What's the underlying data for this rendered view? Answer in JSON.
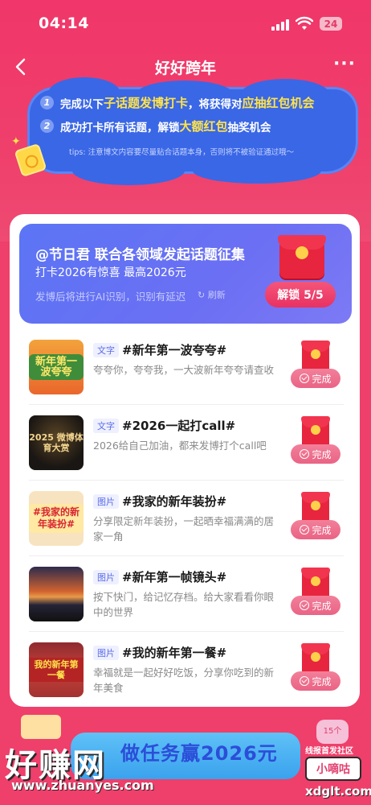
{
  "status_bar": {
    "time": "04:14",
    "battery": "24"
  },
  "nav": {
    "title": "好好跨年"
  },
  "rules": {
    "line1": {
      "num": "1",
      "prefix": "完成以下",
      "h1": "子话题发博打卡",
      "mid": "，将获得对",
      "h2": "应抽红包机会"
    },
    "line2": {
      "num": "2",
      "prefix": "成功打卡所有话题，解锁",
      "h1": "大额红包",
      "suffix": "抽奖机会"
    },
    "tips": "tips: 注意博文内容要尽量贴合话题本身，否则将不被验证通过哦～"
  },
  "banner": {
    "title": "@节日君 联合各领域发起话题征集",
    "subtitle": "打卡2026有惊喜 最高2026元",
    "note": "发博后将进行AI识别，识别有延迟",
    "refresh": "刷新",
    "unlock": "解锁 5/5"
  },
  "tasks": [
    {
      "tag": "文字",
      "title": "#新年第一波夸夸#",
      "desc": "夸夸你，夸夸我，一大波新年夸夸请查收",
      "thumb": "新年第一波夸夸",
      "status": "完成"
    },
    {
      "tag": "文字",
      "title": "#2026一起打call#",
      "desc": "2026给自己加油，都来发博打个call吧",
      "thumb": "2025 微博体育大赏",
      "status": "完成"
    },
    {
      "tag": "图片",
      "title": "#我家的新年装扮#",
      "desc": "分享限定新年装扮，一起晒幸福满满的居家一角",
      "thumb": "#我家的新年装扮#",
      "status": "完成"
    },
    {
      "tag": "图片",
      "title": "#新年第一帧镜头#",
      "desc": "按下快门，给记忆存档。给大家看看你眼中的世界",
      "thumb": "",
      "status": "完成"
    },
    {
      "tag": "图片",
      "title": "#我的新年第一餐#",
      "desc": "幸福就是一起好好吃饭，分享你吃到的新年美食",
      "thumb": "我的新年第一餐",
      "status": "完成"
    }
  ],
  "bottom_banner": {
    "text": "做任务赢2026元",
    "gift_right": "15个"
  },
  "watermark": {
    "left": "好赚网",
    "url": "www.zhuanyes.com",
    "right_top": "线报首发社区",
    "badge": "小嘀咕",
    "right_bottom": "xdglt.com"
  },
  "colors": {
    "accent": "#ef3f6b",
    "cloud": "#3a67e6",
    "banner": "#6b6ff3",
    "highlight": "#ffe34a"
  }
}
